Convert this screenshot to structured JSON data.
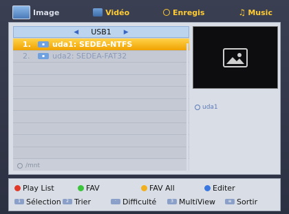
{
  "tabs": [
    {
      "label": "Image",
      "icon": "image-icon",
      "active": true
    },
    {
      "label": "Vidéo",
      "icon": "video-icon",
      "active": false
    },
    {
      "label": "Enregis",
      "icon": "record-icon",
      "active": false
    },
    {
      "label": "Music",
      "icon": "music-icon",
      "active": false
    }
  ],
  "browser": {
    "device_label": "USB1",
    "items": [
      {
        "num": "1.",
        "name": "uda1: SEDEA-NTFS",
        "selected": true
      },
      {
        "num": "2.",
        "name": "uda2: SEDEA-FAT32",
        "selected": false
      }
    ],
    "path": "/mnt"
  },
  "preview": {
    "info": "uda1"
  },
  "legend": {
    "row1": [
      {
        "label": "Play List",
        "color": "#e23a2a"
      },
      {
        "label": "FAV",
        "color": "#3cc43c"
      },
      {
        "label": "FAV All",
        "color": "#f0b020"
      },
      {
        "label": "Editer",
        "color": "#3a78e0"
      }
    ],
    "row2": [
      {
        "label": "Sélection",
        "key": "1"
      },
      {
        "label": "Trier",
        "key": "2"
      },
      {
        "label": "Difficulté",
        "key": "·"
      },
      {
        "label": "MultiView",
        "key": "3"
      },
      {
        "label": "Sortir",
        "key": "≡"
      }
    ]
  },
  "colors": {
    "accent_tab": "#ffcc33",
    "selection": "#f0a200"
  }
}
